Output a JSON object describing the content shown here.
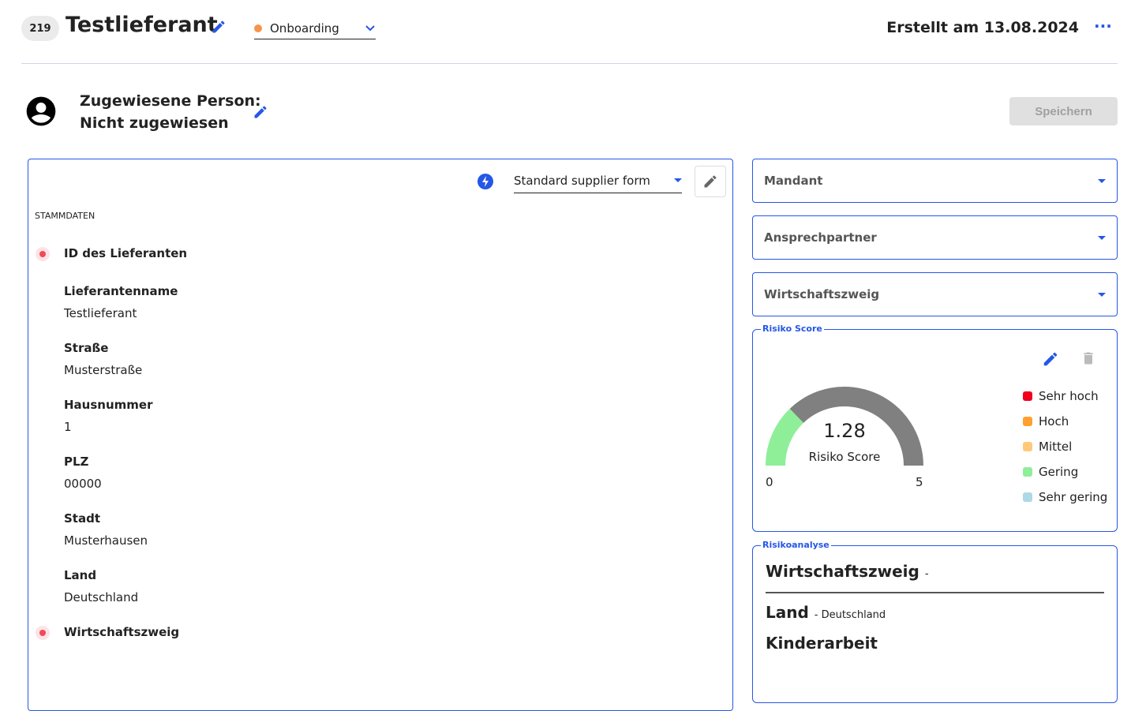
{
  "header": {
    "id_badge": "219",
    "title": "Testlieferant",
    "status": "Onboarding",
    "status_color": "#f7944a",
    "created": "Erstellt am 13.08.2024"
  },
  "assignee": {
    "label": "Zugewiesene Person:",
    "value": "Nicht zugewiesen",
    "save_label": "Speichern"
  },
  "form": {
    "selected_form": "Standard supplier form",
    "section": "STAMMDATEN",
    "fields": [
      {
        "label": "ID des Lieferanten",
        "value": "",
        "required": true
      },
      {
        "label": "Lieferantenname",
        "value": "Testlieferant",
        "required": false
      },
      {
        "label": "Straße",
        "value": "Musterstraße",
        "required": false
      },
      {
        "label": "Hausnummer",
        "value": "1",
        "required": false
      },
      {
        "label": "PLZ",
        "value": "00000",
        "required": false
      },
      {
        "label": "Stadt",
        "value": "Musterhausen",
        "required": false
      },
      {
        "label": "Land",
        "value": "Deutschland",
        "required": false
      },
      {
        "label": "Wirtschaftszweig",
        "value": "",
        "required": true
      }
    ]
  },
  "selects": [
    "Mandant",
    "Ansprechpartner",
    "Wirtschaftszweig"
  ],
  "risk_score": {
    "legend_title": "Risiko Score",
    "value": 1.28,
    "value_text": "1.28",
    "label": "Risiko Score",
    "min": "0",
    "max": "5",
    "fill_color": "#8eef98",
    "track_color": "#808080",
    "legend": [
      {
        "label": "Sehr hoch",
        "color": "#f0001c"
      },
      {
        "label": "Hoch",
        "color": "#ffa030"
      },
      {
        "label": "Mittel",
        "color": "#ffc978"
      },
      {
        "label": "Gering",
        "color": "#8eef98"
      },
      {
        "label": "Sehr gering",
        "color": "#add8e6"
      }
    ]
  },
  "risk_analysis": {
    "legend_title": "Risikoanalyse",
    "items": [
      {
        "title": "Wirtschaftszweig",
        "value": "-"
      },
      {
        "title": "Land",
        "value": "- Deutschland"
      },
      {
        "title": "Kinderarbeit",
        "value": ""
      }
    ]
  }
}
